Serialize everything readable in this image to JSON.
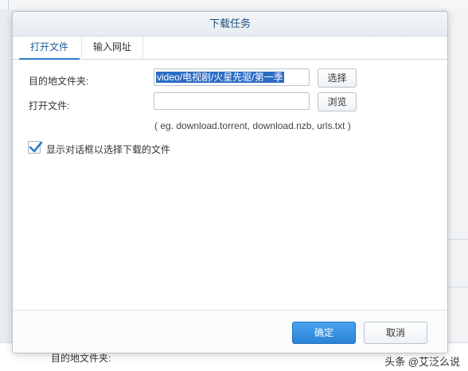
{
  "background": {
    "bottom_label": "目的地文件夹:"
  },
  "watermark": "头条 @艾泛么说",
  "dialog": {
    "title": "下载任务",
    "tabs": [
      {
        "label": "打开文件",
        "active": true
      },
      {
        "label": "输入网址",
        "active": false
      }
    ],
    "destination": {
      "label": "目的地文件夹:",
      "value": "video/电视剧/火星先驱/第一季",
      "select_button": "选择"
    },
    "open_file": {
      "label": "打开文件:",
      "value": "",
      "browse_button": "浏览"
    },
    "hint": "( eg. download.torrent, download.nzb, urls.txt )",
    "checkbox": {
      "label": "显示对话框以选择下载的文件",
      "checked": true
    },
    "ok_button": "确定",
    "cancel_button": "取消"
  },
  "colors": {
    "accent": "#2a82d6",
    "title_text": "#1f4d7c",
    "selection": "#2b6cc4"
  }
}
